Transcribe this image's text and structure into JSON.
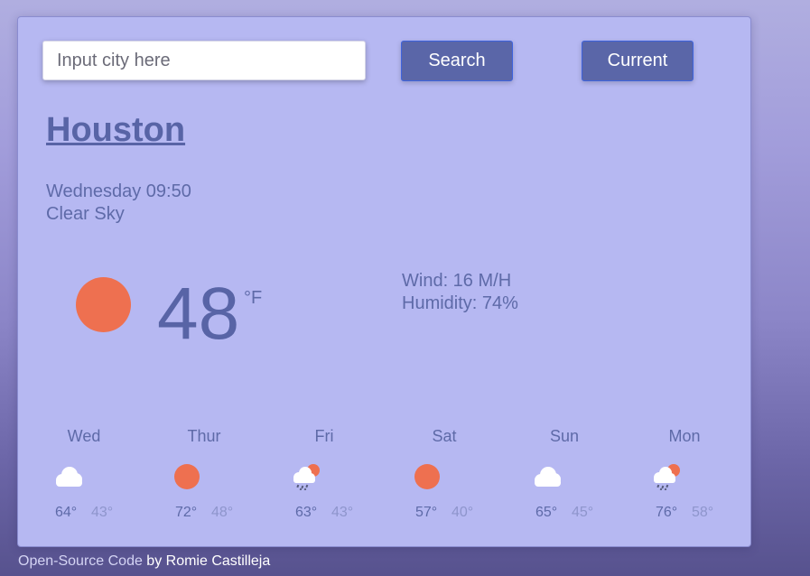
{
  "search": {
    "placeholder": "Input city here",
    "value": ""
  },
  "buttons": {
    "search": "Search",
    "current": "Current"
  },
  "current": {
    "city": "Houston",
    "day_time": "Wednesday 09:50",
    "condition": "Clear Sky",
    "temperature": "48",
    "unit": "°F",
    "wind": "Wind: 16 M/H",
    "humidity": "Humidity: 74%",
    "icon": "sun-icon"
  },
  "forecast": [
    {
      "day": "Wed",
      "icon": "cloud-icon",
      "max": "64°",
      "min": "43°"
    },
    {
      "day": "Thur",
      "icon": "sun-icon",
      "max": "72°",
      "min": "48°"
    },
    {
      "day": "Fri",
      "icon": "sun-rain-icon",
      "max": "63°",
      "min": "43°"
    },
    {
      "day": "Sat",
      "icon": "sun-icon",
      "max": "57°",
      "min": "40°"
    },
    {
      "day": "Sun",
      "icon": "cloud-icon",
      "max": "65°",
      "min": "45°"
    },
    {
      "day": "Mon",
      "icon": "sun-rain-icon",
      "max": "76°",
      "min": "58°"
    }
  ],
  "footer": {
    "link": "Open-Source Code",
    "text": " by Romie Castilleja"
  },
  "colors": {
    "accent": "#5864a6",
    "sun": "#ee7050",
    "card": "#b6b8f2",
    "button": "#5a66a8"
  }
}
